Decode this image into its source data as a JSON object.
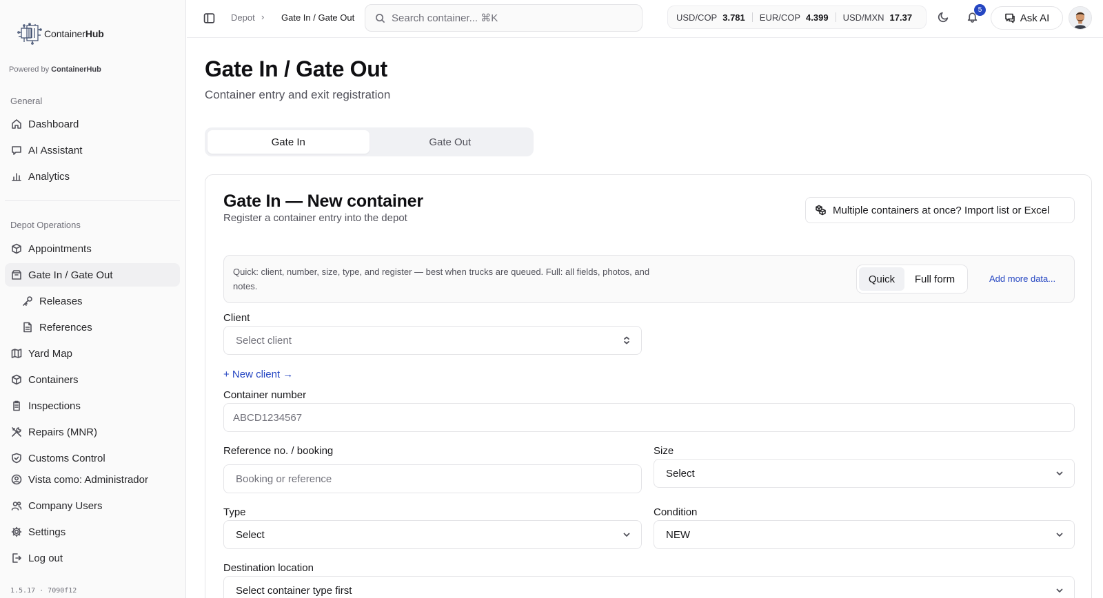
{
  "app": {
    "logo_text_light": "Container",
    "logo_text_bold": "Hub",
    "powered_prefix": "Powered by ",
    "powered_brand": "ContainerHub",
    "version": "1.5.17 · 7090f12"
  },
  "sidebar": {
    "section_general": "General",
    "general_items": [
      {
        "label": "Dashboard",
        "icon": "home-icon"
      },
      {
        "label": "AI Assistant",
        "icon": "chat-icon"
      },
      {
        "label": "Analytics",
        "icon": "bar-chart-icon"
      }
    ],
    "section_depot": "Depot Operations",
    "depot_items": [
      {
        "label": "Appointments",
        "icon": "box-icon"
      },
      {
        "label": "Gate In / Gate Out",
        "icon": "gate-icon",
        "active": true
      },
      {
        "label": "Releases",
        "icon": "key-icon",
        "sub": true
      },
      {
        "label": "References",
        "icon": "file-icon",
        "sub": true
      },
      {
        "label": "Yard Map",
        "icon": "map-icon"
      },
      {
        "label": "Containers",
        "icon": "box-icon"
      },
      {
        "label": "Inspections",
        "icon": "clipboard-icon"
      },
      {
        "label": "Repairs (MNR)",
        "icon": "tools-icon"
      },
      {
        "label": "Customs Control",
        "icon": "shield-icon"
      }
    ],
    "bottom_items": [
      {
        "label": "Vista como: Administrador",
        "icon": "user-circle-icon"
      },
      {
        "label": "Company Users",
        "icon": "users-icon"
      },
      {
        "label": "Settings",
        "icon": "gear-icon"
      },
      {
        "label": "Log out",
        "icon": "logout-icon"
      }
    ]
  },
  "header": {
    "breadcrumb_root": "Depot",
    "breadcrumb_sep": "›",
    "breadcrumb_current": "Gate In / Gate Out",
    "search_placeholder": "Search container... ⌘K",
    "fx": [
      {
        "pair": "USD/COP",
        "rate": "3.781"
      },
      {
        "pair": "EUR/COP",
        "rate": "4.399"
      },
      {
        "pair": "USD/MXN",
        "rate": "17.37"
      }
    ],
    "notifications_count": "5",
    "ask_ai_label": "Ask AI"
  },
  "main": {
    "title": "Gate In / Gate Out",
    "subtitle": "Container entry and exit registration",
    "tabs": [
      {
        "label": "Gate In",
        "active": true
      },
      {
        "label": "Gate Out",
        "active": false
      }
    ],
    "card": {
      "title": "Gate In — New container",
      "subtitle": "Register a container entry into the depot",
      "import_label": "Multiple containers at once? Import list or Excel",
      "mode_hint": "Quick: client, number, size, type, and register — best when trucks are queued. Full: all fields, photos, and notes.",
      "mode_quick": "Quick",
      "mode_full": "Full form",
      "more_link": "Add more data...",
      "client_label": "Client",
      "client_placeholder": "Select client",
      "new_client_link": "+ New client →",
      "container_label": "Container number",
      "container_placeholder": "ABCD1234567",
      "reference_label": "Reference no. / booking",
      "reference_placeholder": "Booking or reference",
      "size_label": "Size",
      "size_value": "Select",
      "type_label": "Type",
      "type_value": "Select",
      "condition_label": "Condition",
      "condition_value": "NEW",
      "destination_label": "Destination location",
      "destination_value": "Select container type first"
    }
  },
  "colors": {
    "accent": "#2546c2",
    "sidebar_bg": "#fafafa",
    "active_bg": "#f0f0f2"
  }
}
